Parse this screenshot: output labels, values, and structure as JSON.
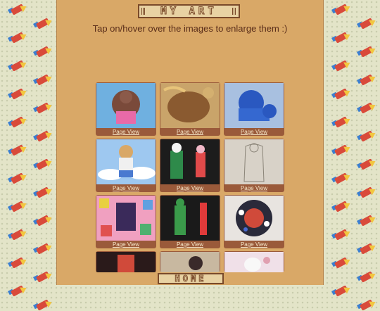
{
  "header": {
    "title": "MY ART"
  },
  "subtitle": "Tap on/hover over the images to enlarge them :)",
  "gallery": {
    "link_label": "Page View",
    "items": [
      {
        "alt": "bear character in pink outfit"
      },
      {
        "alt": "brown creature illustration"
      },
      {
        "alt": "blue lion figure"
      },
      {
        "alt": "bear in sky with clouds"
      },
      {
        "alt": "green creature and pink character"
      },
      {
        "alt": "pencil sketch figure"
      },
      {
        "alt": "colorful patterned illustration"
      },
      {
        "alt": "green and red figures"
      },
      {
        "alt": "beaded ornament"
      },
      {
        "alt": "partial artwork 1"
      },
      {
        "alt": "partial artwork 2"
      },
      {
        "alt": "partial artwork 3"
      }
    ]
  },
  "footer": {
    "home_label": "HOME"
  },
  "colors": {
    "panel": "#d9a867",
    "card": "#9a5a3a",
    "text": "#5a2e1a",
    "pencil": "#d94a3a"
  }
}
